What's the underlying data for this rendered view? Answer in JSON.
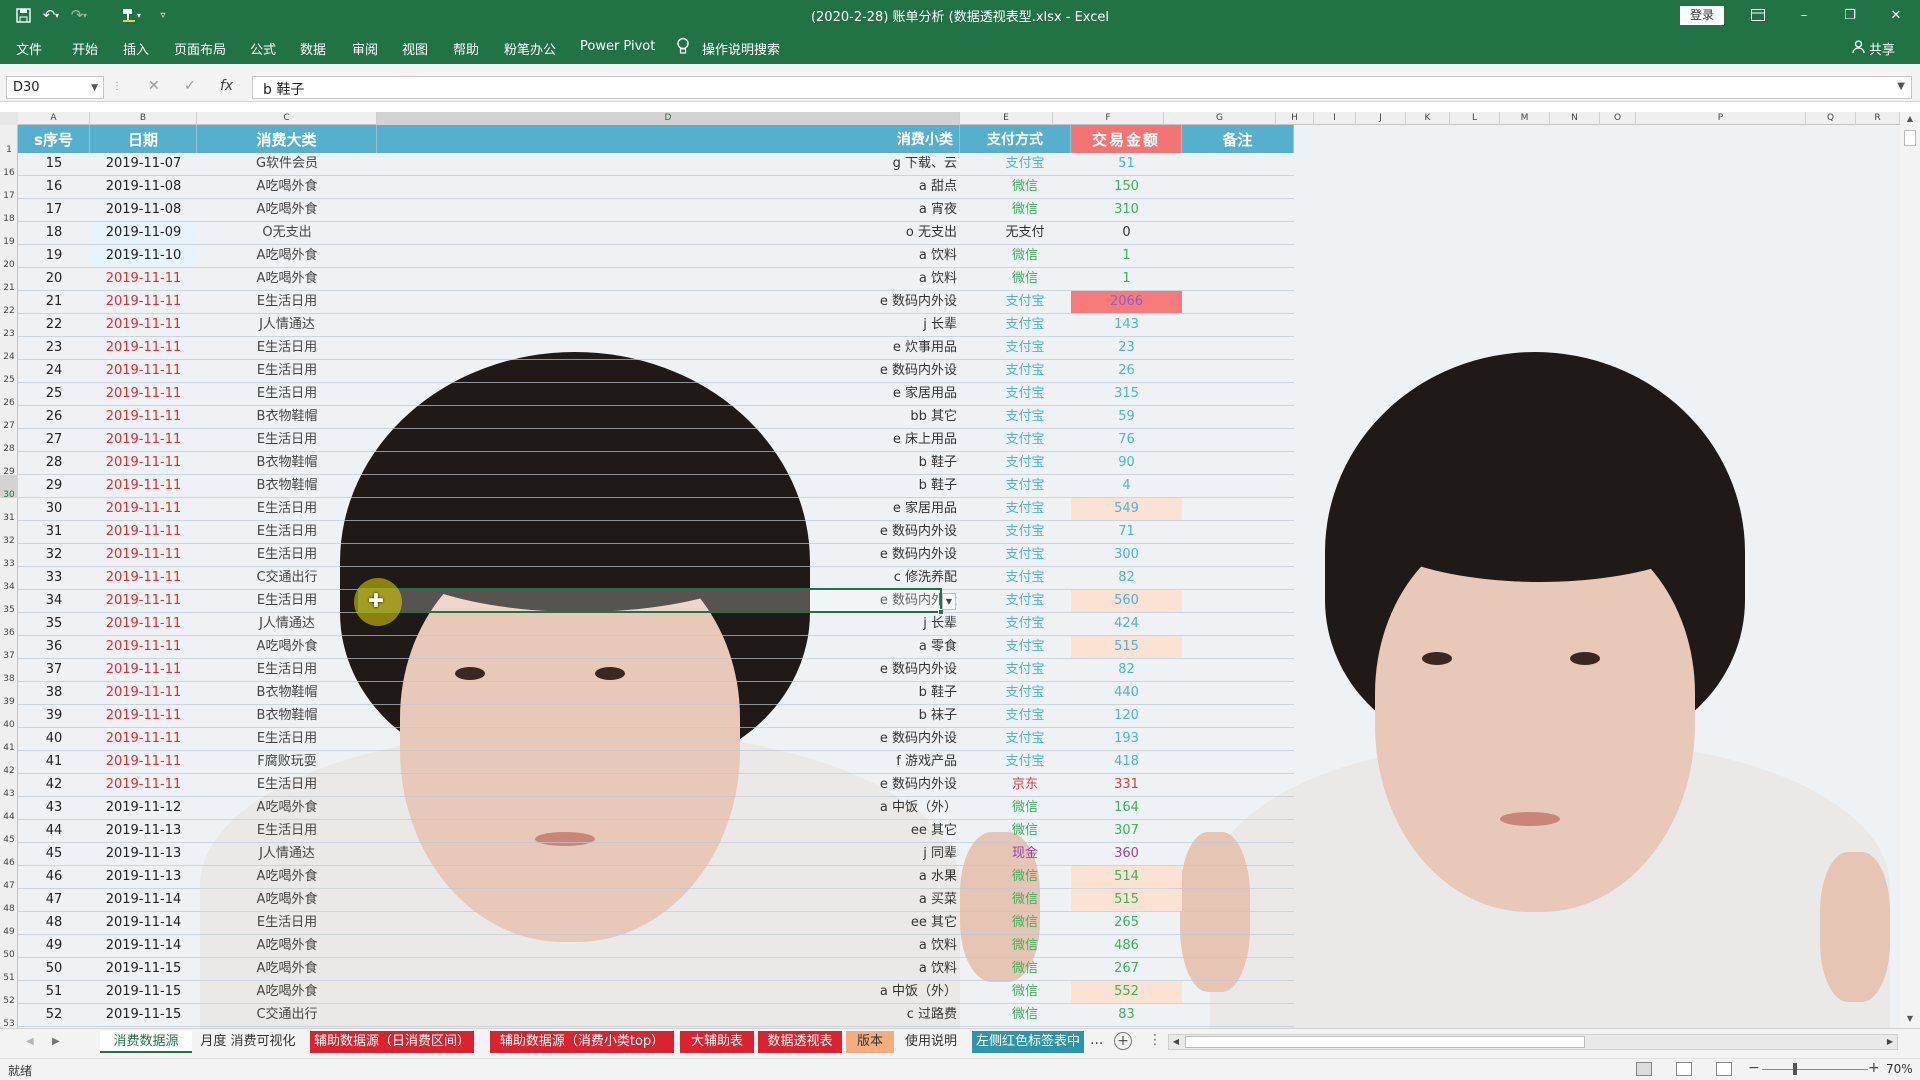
{
  "window": {
    "title": "(2020-2-28) 账单分析 (数据透视表型.xlsx - Excel",
    "login_label": "登录",
    "minimize": "–",
    "restore": "❐",
    "close": "✕"
  },
  "ribbon": {
    "tabs": [
      "文件",
      "开始",
      "插入",
      "页面布局",
      "公式",
      "数据",
      "审阅",
      "视图",
      "帮助",
      "粉笔办公",
      "Power Pivot",
      "操作说明搜索"
    ],
    "share_label": "共享"
  },
  "formula_bar": {
    "name_box": "D30",
    "fx": "fx",
    "formula": "b 鞋子"
  },
  "columns": [
    "A",
    "B",
    "C",
    "D",
    "E",
    "F",
    "G",
    "H",
    "I",
    "J",
    "K",
    "L",
    "M",
    "N",
    "O",
    "P",
    "Q",
    "R"
  ],
  "row_numbers": [
    "1",
    "16",
    "17",
    "18",
    "19",
    "20",
    "21",
    "22",
    "23",
    "24",
    "25",
    "26",
    "27",
    "28",
    "29",
    "30",
    "31",
    "32",
    "33",
    "34",
    "35",
    "36",
    "37",
    "38",
    "39",
    "40",
    "41",
    "42",
    "43",
    "44",
    "45",
    "46",
    "47",
    "48",
    "49",
    "50",
    "51",
    "52",
    "53"
  ],
  "headers": {
    "seq": "s序号",
    "date": "日期",
    "category": "消费大类",
    "subcategory": "消费小类",
    "payment": "支付方式",
    "amount": "交易金额",
    "note": "备注"
  },
  "colors": {
    "alipay": "#4db2e3",
    "wechat": "#3bb35c",
    "cash": "#9b3fb5",
    "jd": "#e23b3b",
    "none": "#333333",
    "header_bg": "#56afcc",
    "amount_header_bg": "#f47474",
    "excel_green": "#217346"
  },
  "rows": [
    {
      "seq": "15",
      "date": "2019-11-07",
      "red": false,
      "hl": false,
      "category": "G软件会员",
      "subcategory": "g 下载、云",
      "payment": "支付宝",
      "pay_type": "alipay",
      "amount": "51",
      "amt_level": "none"
    },
    {
      "seq": "16",
      "date": "2019-11-08",
      "red": false,
      "hl": false,
      "category": "A吃喝外食",
      "subcategory": "a 甜点",
      "payment": "微信",
      "pay_type": "wechat",
      "amount": "150",
      "amt_level": "none"
    },
    {
      "seq": "17",
      "date": "2019-11-08",
      "red": false,
      "hl": false,
      "category": "A吃喝外食",
      "subcategory": "a 宵夜",
      "payment": "微信",
      "pay_type": "wechat",
      "amount": "310",
      "amt_level": "none"
    },
    {
      "seq": "18",
      "date": "2019-11-09",
      "red": false,
      "hl": true,
      "category": "O无支出",
      "subcategory": "o 无支出",
      "payment": "无支付",
      "pay_type": "none",
      "amount": "0",
      "amt_level": "none"
    },
    {
      "seq": "19",
      "date": "2019-11-10",
      "red": false,
      "hl": true,
      "category": "A吃喝外食",
      "subcategory": "a 饮料",
      "payment": "微信",
      "pay_type": "wechat",
      "amount": "1",
      "amt_level": "none"
    },
    {
      "seq": "20",
      "date": "2019-11-11",
      "red": true,
      "hl": false,
      "category": "A吃喝外食",
      "subcategory": "a 饮料",
      "payment": "微信",
      "pay_type": "wechat",
      "amount": "1",
      "amt_level": "none"
    },
    {
      "seq": "21",
      "date": "2019-11-11",
      "red": true,
      "hl": false,
      "category": "E生活日用",
      "subcategory": "e 数码内外设",
      "payment": "支付宝",
      "pay_type": "alipay",
      "amount": "2066",
      "amt_level": "big"
    },
    {
      "seq": "22",
      "date": "2019-11-11",
      "red": true,
      "hl": false,
      "category": "J人情通达",
      "subcategory": "j 长辈",
      "payment": "支付宝",
      "pay_type": "alipay",
      "amount": "143",
      "amt_level": "none"
    },
    {
      "seq": "23",
      "date": "2019-11-11",
      "red": true,
      "hl": false,
      "category": "E生活日用",
      "subcategory": "e 炊事用品",
      "payment": "支付宝",
      "pay_type": "alipay",
      "amount": "23",
      "amt_level": "none"
    },
    {
      "seq": "24",
      "date": "2019-11-11",
      "red": true,
      "hl": false,
      "category": "E生活日用",
      "subcategory": "e 数码内外设",
      "payment": "支付宝",
      "pay_type": "alipay",
      "amount": "26",
      "amt_level": "none"
    },
    {
      "seq": "25",
      "date": "2019-11-11",
      "red": true,
      "hl": false,
      "category": "E生活日用",
      "subcategory": "e 家居用品",
      "payment": "支付宝",
      "pay_type": "alipay",
      "amount": "315",
      "amt_level": "none"
    },
    {
      "seq": "26",
      "date": "2019-11-11",
      "red": true,
      "hl": false,
      "category": "B衣物鞋帽",
      "subcategory": "bb 其它",
      "payment": "支付宝",
      "pay_type": "alipay",
      "amount": "59",
      "amt_level": "none"
    },
    {
      "seq": "27",
      "date": "2019-11-11",
      "red": true,
      "hl": false,
      "category": "E生活日用",
      "subcategory": "e 床上用品",
      "payment": "支付宝",
      "pay_type": "alipay",
      "amount": "76",
      "amt_level": "none"
    },
    {
      "seq": "28",
      "date": "2019-11-11",
      "red": true,
      "hl": false,
      "category": "B衣物鞋帽",
      "subcategory": "b 鞋子",
      "payment": "支付宝",
      "pay_type": "alipay",
      "amount": "90",
      "amt_level": "none"
    },
    {
      "seq": "29",
      "date": "2019-11-11",
      "red": true,
      "hl": false,
      "category": "B衣物鞋帽",
      "subcategory": "b 鞋子",
      "payment": "支付宝",
      "pay_type": "alipay",
      "amount": "4",
      "amt_level": "none"
    },
    {
      "seq": "30",
      "date": "2019-11-11",
      "red": true,
      "hl": false,
      "category": "E生活日用",
      "subcategory": "e 家居用品",
      "payment": "支付宝",
      "pay_type": "alipay",
      "amount": "549",
      "amt_level": "mid"
    },
    {
      "seq": "31",
      "date": "2019-11-11",
      "red": true,
      "hl": false,
      "category": "E生活日用",
      "subcategory": "e 数码内外设",
      "payment": "支付宝",
      "pay_type": "alipay",
      "amount": "71",
      "amt_level": "none"
    },
    {
      "seq": "32",
      "date": "2019-11-11",
      "red": true,
      "hl": false,
      "category": "E生活日用",
      "subcategory": "e 数码内外设",
      "payment": "支付宝",
      "pay_type": "alipay",
      "amount": "300",
      "amt_level": "none"
    },
    {
      "seq": "33",
      "date": "2019-11-11",
      "red": true,
      "hl": false,
      "category": "C交通出行",
      "subcategory": "c 修洗养配",
      "payment": "支付宝",
      "pay_type": "alipay",
      "amount": "82",
      "amt_level": "none"
    },
    {
      "seq": "34",
      "date": "2019-11-11",
      "red": true,
      "hl": false,
      "category": "E生活日用",
      "subcategory": "e 数码内外设",
      "payment": "支付宝",
      "pay_type": "alipay",
      "amount": "560",
      "amt_level": "mid"
    },
    {
      "seq": "35",
      "date": "2019-11-11",
      "red": true,
      "hl": false,
      "category": "J人情通达",
      "subcategory": "j 长辈",
      "payment": "支付宝",
      "pay_type": "alipay",
      "amount": "424",
      "amt_level": "none"
    },
    {
      "seq": "36",
      "date": "2019-11-11",
      "red": true,
      "hl": false,
      "category": "A吃喝外食",
      "subcategory": "a 零食",
      "payment": "支付宝",
      "pay_type": "alipay",
      "amount": "515",
      "amt_level": "mid"
    },
    {
      "seq": "37",
      "date": "2019-11-11",
      "red": true,
      "hl": false,
      "category": "E生活日用",
      "subcategory": "e 数码内外设",
      "payment": "支付宝",
      "pay_type": "alipay",
      "amount": "82",
      "amt_level": "none"
    },
    {
      "seq": "38",
      "date": "2019-11-11",
      "red": true,
      "hl": false,
      "category": "B衣物鞋帽",
      "subcategory": "b 鞋子",
      "payment": "支付宝",
      "pay_type": "alipay",
      "amount": "440",
      "amt_level": "none"
    },
    {
      "seq": "39",
      "date": "2019-11-11",
      "red": true,
      "hl": false,
      "category": "B衣物鞋帽",
      "subcategory": "b 袜子",
      "payment": "支付宝",
      "pay_type": "alipay",
      "amount": "120",
      "amt_level": "none"
    },
    {
      "seq": "40",
      "date": "2019-11-11",
      "red": true,
      "hl": false,
      "category": "E生活日用",
      "subcategory": "e 数码内外设",
      "payment": "支付宝",
      "pay_type": "alipay",
      "amount": "193",
      "amt_level": "none"
    },
    {
      "seq": "41",
      "date": "2019-11-11",
      "red": true,
      "hl": false,
      "category": "F腐败玩耍",
      "subcategory": "f 游戏产品",
      "payment": "支付宝",
      "pay_type": "alipay",
      "amount": "418",
      "amt_level": "none"
    },
    {
      "seq": "42",
      "date": "2019-11-11",
      "red": true,
      "hl": false,
      "category": "E生活日用",
      "subcategory": "e 数码内外设",
      "payment": "京东",
      "pay_type": "jd",
      "amount": "331",
      "amt_level": "none"
    },
    {
      "seq": "43",
      "date": "2019-11-12",
      "red": false,
      "hl": false,
      "category": "A吃喝外食",
      "subcategory": "a 中饭（外）",
      "payment": "微信",
      "pay_type": "wechat",
      "amount": "164",
      "amt_level": "none"
    },
    {
      "seq": "44",
      "date": "2019-11-13",
      "red": false,
      "hl": false,
      "category": "E生活日用",
      "subcategory": "ee 其它",
      "payment": "微信",
      "pay_type": "wechat",
      "amount": "307",
      "amt_level": "none"
    },
    {
      "seq": "45",
      "date": "2019-11-13",
      "red": false,
      "hl": false,
      "category": "J人情通达",
      "subcategory": "j 同辈",
      "payment": "现金",
      "pay_type": "cash",
      "amount": "360",
      "amt_level": "none"
    },
    {
      "seq": "46",
      "date": "2019-11-13",
      "red": false,
      "hl": false,
      "category": "A吃喝外食",
      "subcategory": "a 水果",
      "payment": "微信",
      "pay_type": "wechat",
      "amount": "514",
      "amt_level": "mid"
    },
    {
      "seq": "47",
      "date": "2019-11-14",
      "red": false,
      "hl": false,
      "category": "A吃喝外食",
      "subcategory": "a 买菜",
      "payment": "微信",
      "pay_type": "wechat",
      "amount": "515",
      "amt_level": "mid"
    },
    {
      "seq": "48",
      "date": "2019-11-14",
      "red": false,
      "hl": false,
      "category": "E生活日用",
      "subcategory": "ee 其它",
      "payment": "微信",
      "pay_type": "wechat",
      "amount": "265",
      "amt_level": "none"
    },
    {
      "seq": "49",
      "date": "2019-11-14",
      "red": false,
      "hl": false,
      "category": "A吃喝外食",
      "subcategory": "a 饮料",
      "payment": "微信",
      "pay_type": "wechat",
      "amount": "486",
      "amt_level": "none"
    },
    {
      "seq": "50",
      "date": "2019-11-15",
      "red": false,
      "hl": false,
      "category": "A吃喝外食",
      "subcategory": "a 饮料",
      "payment": "微信",
      "pay_type": "wechat",
      "amount": "267",
      "amt_level": "none"
    },
    {
      "seq": "51",
      "date": "2019-11-15",
      "red": false,
      "hl": false,
      "category": "A吃喝外食",
      "subcategory": "a 中饭（外）",
      "payment": "微信",
      "pay_type": "wechat",
      "amount": "552",
      "amt_level": "mid"
    },
    {
      "seq": "52",
      "date": "2019-11-15",
      "red": false,
      "hl": false,
      "category": "C交通出行",
      "subcategory": "c 过路费",
      "payment": "微信",
      "pay_type": "wechat",
      "amount": "83",
      "amt_level": "none"
    }
  ],
  "sheet_tabs": [
    {
      "label": "消费数据源",
      "style": "active"
    },
    {
      "label": "月度 消费可视化",
      "style": "plain"
    },
    {
      "label": "辅助数据源（日消费区间）",
      "style": "red"
    },
    {
      "label": "辅助数据源（消费小类top）",
      "style": "red"
    },
    {
      "label": "大辅助表",
      "style": "red"
    },
    {
      "label": "数据透视表",
      "style": "red"
    },
    {
      "label": "版本",
      "style": "orange"
    },
    {
      "label": "使用说明",
      "style": "plain"
    },
    {
      "label": "左侧红色标签表中",
      "style": "teal"
    }
  ],
  "sheet_more": "...",
  "status": {
    "ready": "就绪",
    "zoom": "70%"
  }
}
